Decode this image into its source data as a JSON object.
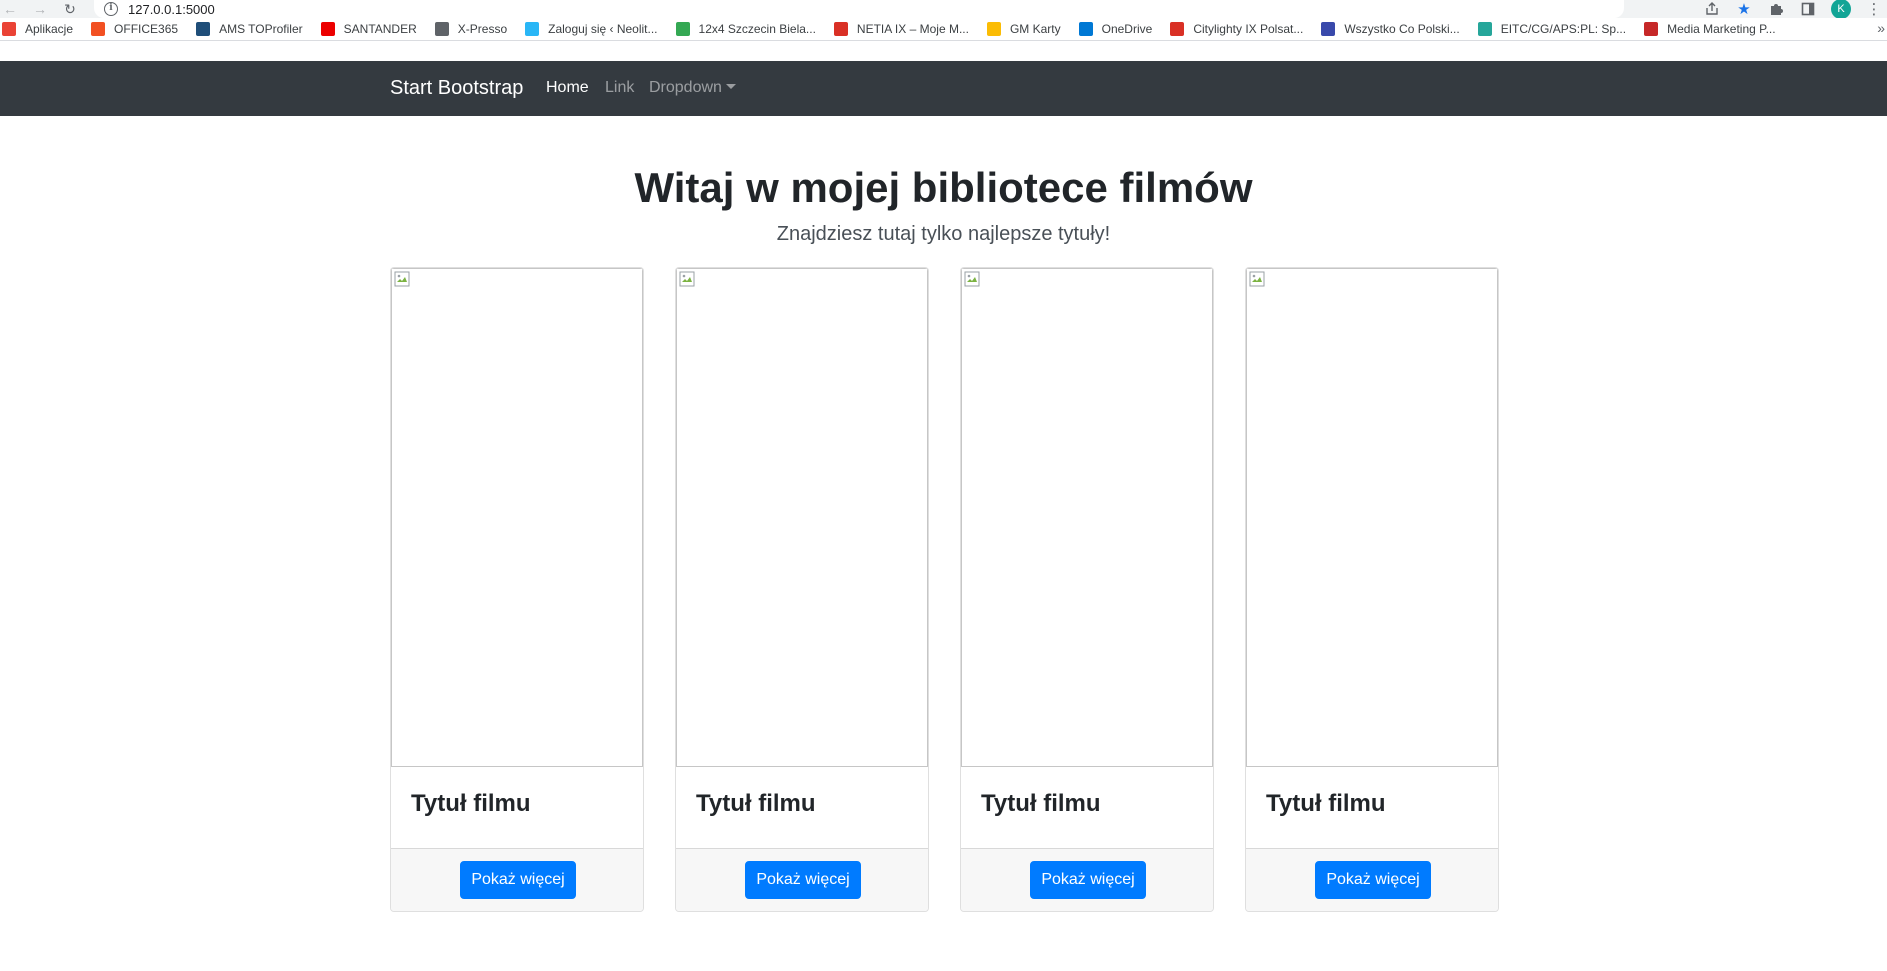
{
  "browser": {
    "url": "127.0.0.1:5000",
    "avatar_letter": "K",
    "bookmarks": [
      {
        "label": "Aplikacje",
        "icon": "apps-grid-icon",
        "color": "#ea4335"
      },
      {
        "label": "OFFICE365",
        "icon": "office-icon",
        "color": "#f25022"
      },
      {
        "label": "AMS TOProfiler",
        "icon": "chevron-logo-icon",
        "color": "#1f4e79"
      },
      {
        "label": "SANTANDER",
        "icon": "santander-icon",
        "color": "#ec0000"
      },
      {
        "label": "X-Presso",
        "icon": "globe-icon",
        "color": "#5f6368"
      },
      {
        "label": "Zaloguj się ‹ Neolit...",
        "icon": "neolit-icon",
        "color": "#29b6f6"
      },
      {
        "label": "12x4 Szczecin Biela...",
        "icon": "pinwheel-icon",
        "color": "#34a853"
      },
      {
        "label": "NETIA IX – Moje M...",
        "icon": "map-pin-icon",
        "color": "#d93025"
      },
      {
        "label": "GM Karty",
        "icon": "drive-icon",
        "color": "#fbbc04"
      },
      {
        "label": "OneDrive",
        "icon": "cloud-icon",
        "color": "#0078d4"
      },
      {
        "label": "Citylighty IX Polsat...",
        "icon": "map-pin-icon",
        "color": "#d93025"
      },
      {
        "label": "Wszystko Co Polski...",
        "icon": "site-icon",
        "color": "#3949ab"
      },
      {
        "label": "EITC/CG/APS:PL: Sp...",
        "icon": "grid-icon",
        "color": "#26a69a"
      },
      {
        "label": "Media Marketing P...",
        "icon": "wave-icon",
        "color": "#c62828"
      }
    ]
  },
  "navbar": {
    "brand": "Start Bootstrap",
    "links": [
      "Home",
      "Link",
      "Dropdown"
    ]
  },
  "hero": {
    "title": "Witaj w mojej bibliotece filmów",
    "subtitle": "Znajdziesz tutaj tylko najlepsze tytuły!"
  },
  "cards": [
    {
      "title": "Tytuł filmu",
      "button": "Pokaż więcej"
    },
    {
      "title": "Tytuł filmu",
      "button": "Pokaż więcej"
    },
    {
      "title": "Tytuł filmu",
      "button": "Pokaż więcej"
    },
    {
      "title": "Tytuł filmu",
      "button": "Pokaż więcej"
    }
  ],
  "colors": {
    "navbar_bg": "#343a40",
    "primary": "#007bff",
    "footer_bg": "#f7f7f7"
  }
}
